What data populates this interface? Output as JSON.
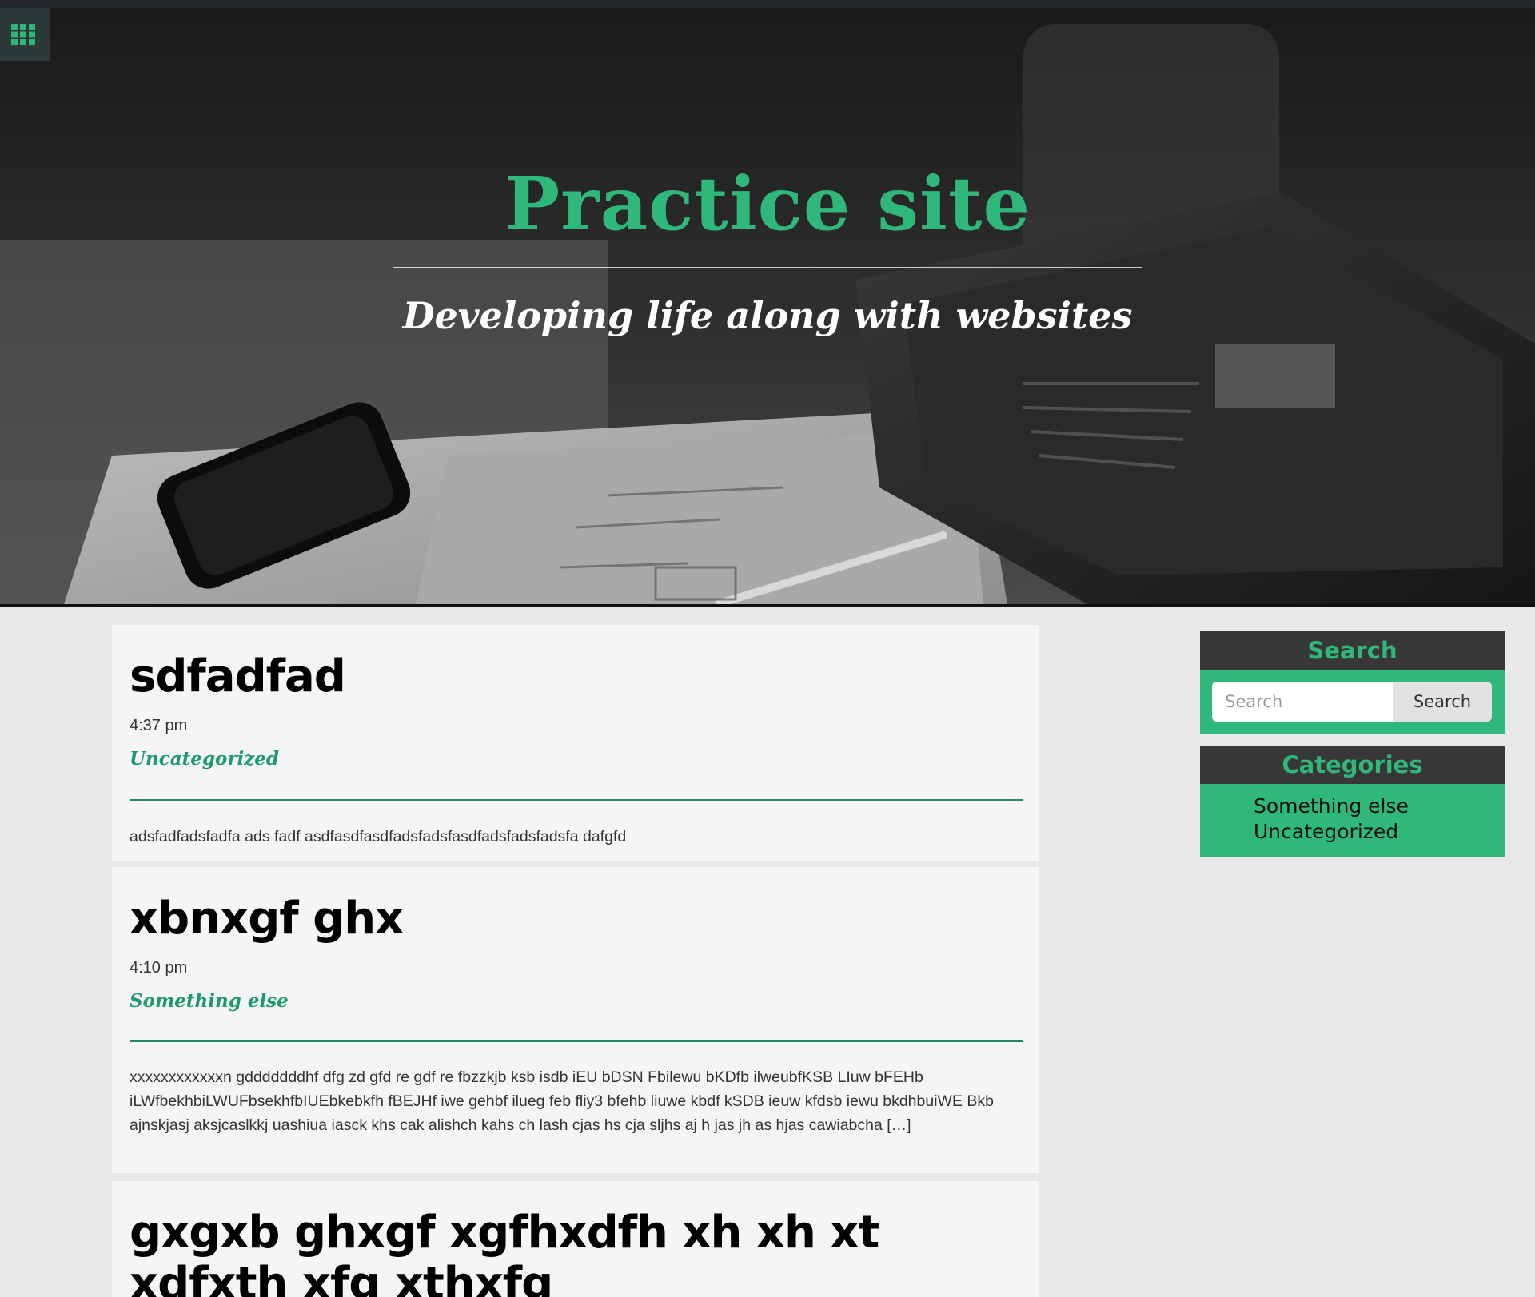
{
  "header": {
    "menu_icon": "grid-icon",
    "site_title": "Practice site",
    "tagline": "Developing life along with websites"
  },
  "posts": [
    {
      "title": "sdfadfad",
      "time": "4:37 pm",
      "category": "Uncategorized",
      "excerpt": "adsfadfadsfadfa ads fadf asdfasdfasdfadsfadsfasdfadsfadsfadsfa dafgfd"
    },
    {
      "title": "xbnxgf ghx",
      "time": "4:10 pm",
      "category": "Something else",
      "excerpt": "xxxxxxxxxxxxn gdddddddhf dfg zd gfd re gdf re fbzzkjb ksb isdb iEU bDSN Fbilewu bKDfb ilweubfKSB LIuw bFEHb iLWfbekhbiLWUFbsekhfbIUEbkebkfh fBEJHf iwe gehbf ilueg feb fliy3 bfehb liuwe kbdf kSDB ieuw kfdsb iewu bkdhbuiWE Bkb ajnskjasj aksjcaslkkj uashiua iasck khs cak alishch kahs ch lash cjas hs cja sljhs aj h jas jh as hjas cawiabcha […]"
    },
    {
      "title": "gxgxb ghxgf xgfhxdfh xh xh xt xdfxth xfg xthxfg"
    }
  ],
  "sidebar": {
    "search": {
      "heading": "Search",
      "placeholder": "Search",
      "button_label": "Search"
    },
    "categories": {
      "heading": "Categories",
      "items": [
        "Something else",
        "Uncategorized"
      ]
    }
  },
  "colors": {
    "accent": "#2fb87a",
    "widget_head_bg": "#373737",
    "page_bg": "#e8e8e8",
    "card_bg": "#f5f5f5"
  }
}
